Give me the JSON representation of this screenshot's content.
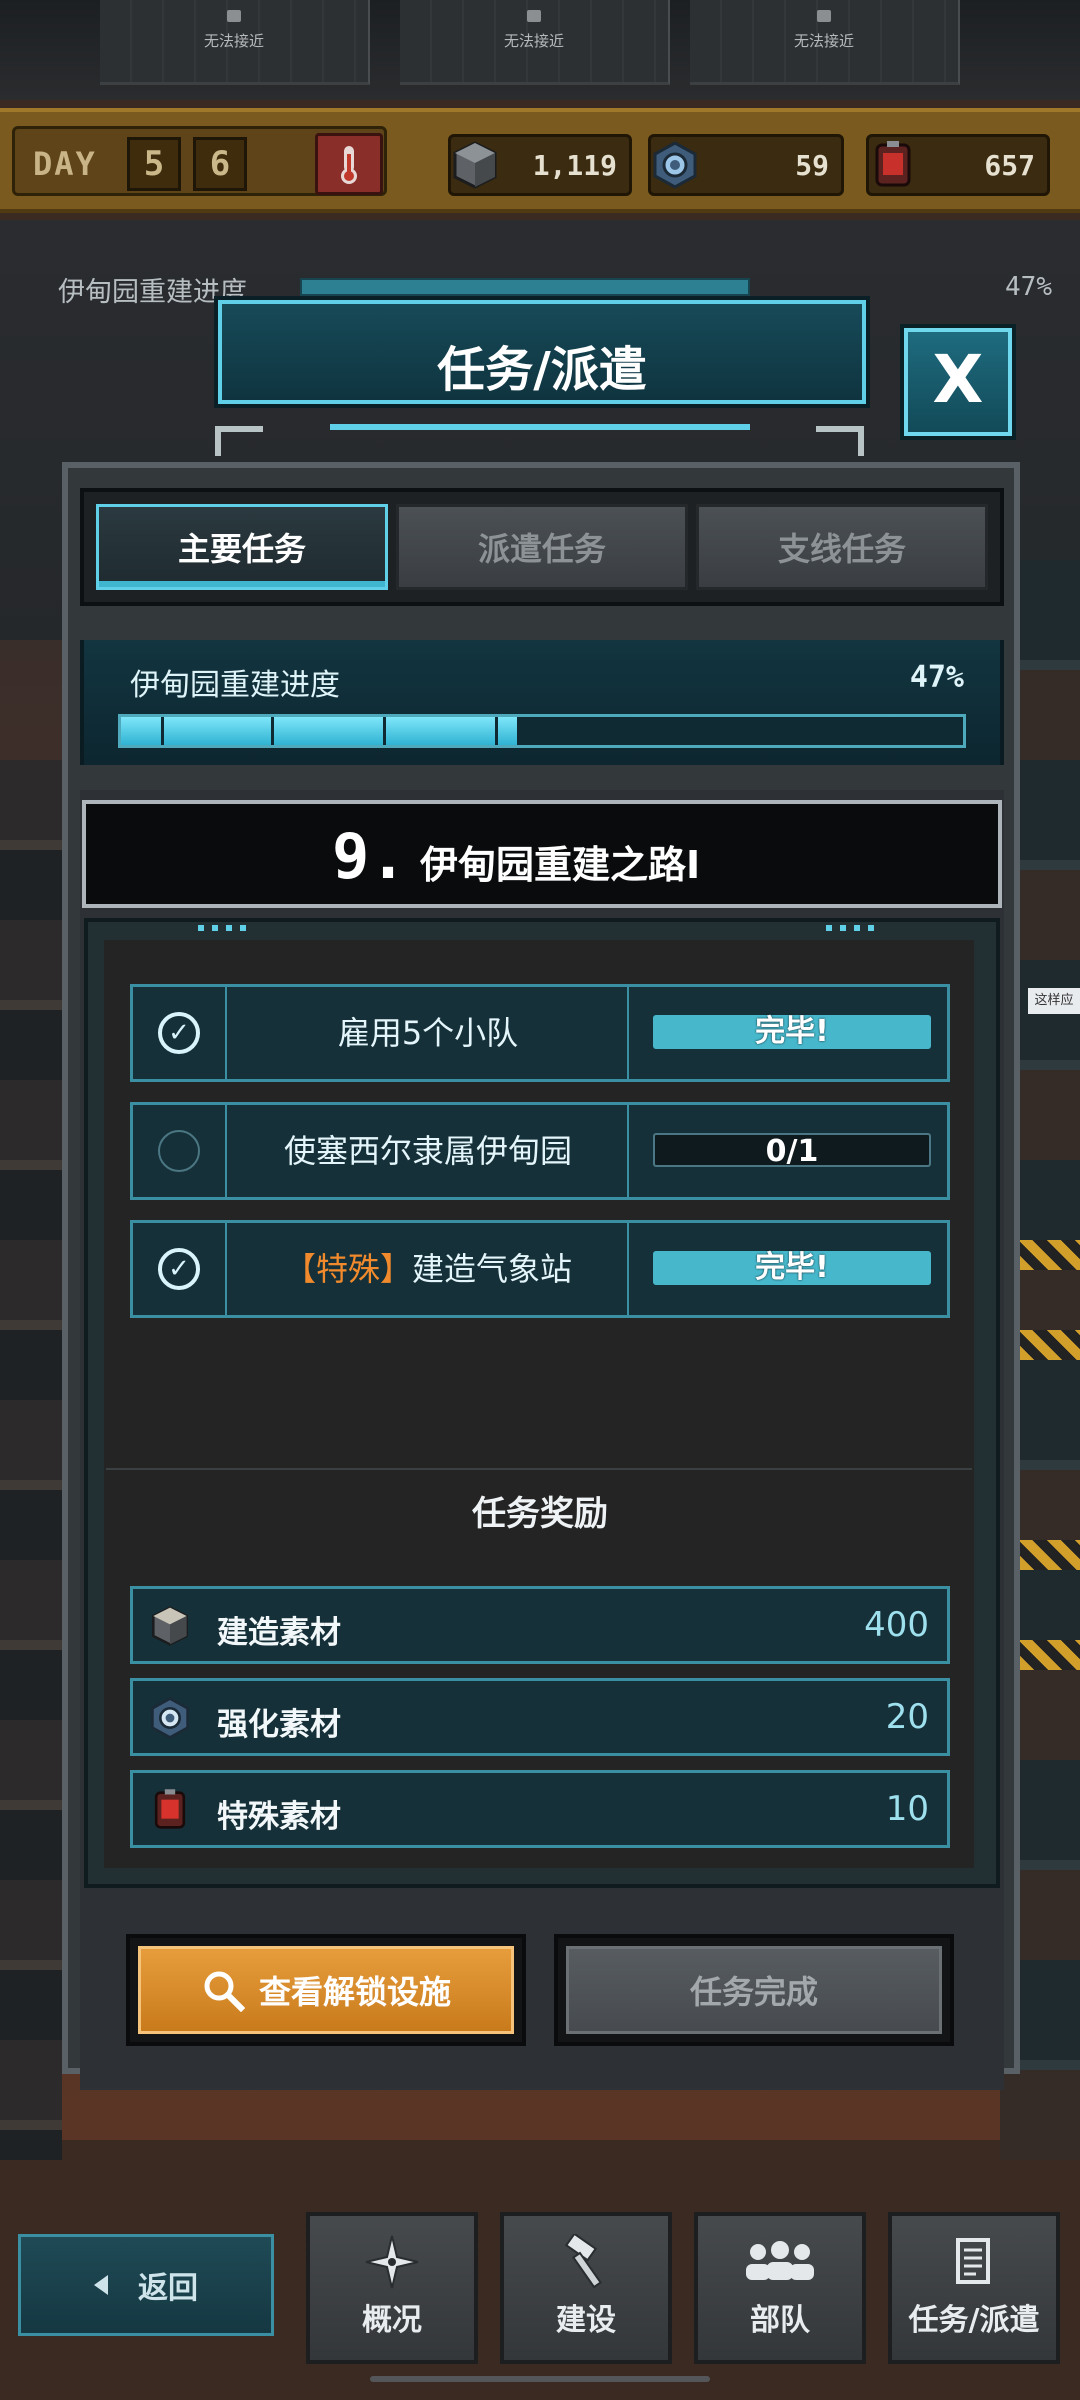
{
  "background": {
    "locked_slots": [
      "无法接近",
      "无法接近",
      "无法接近"
    ],
    "resource_bar": {
      "day_label": "DAY",
      "day_digits": [
        "5",
        "6"
      ],
      "resources": [
        {
          "name": "build-material",
          "icon": "build-material-icon",
          "value": "1,119"
        },
        {
          "name": "enhance-material",
          "icon": "gear-icon",
          "value": "59"
        },
        {
          "name": "special-material",
          "icon": "special-material-icon",
          "value": "657"
        }
      ]
    },
    "bg_progress_label": "伊甸园重建进度",
    "bg_progress_pct": "47%",
    "side_tag": "这样应"
  },
  "modal": {
    "title": "任务/派遣",
    "close_label": "X",
    "tabs": [
      {
        "label": "主要任务",
        "active": true
      },
      {
        "label": "派遣任务",
        "active": false
      },
      {
        "label": "支线任务",
        "active": false
      }
    ],
    "progress": {
      "label": "伊甸园重建进度",
      "percent_text": "47%",
      "fill_fraction": 0.47
    },
    "mission": {
      "number": "9.",
      "name": "伊甸园重建之路I"
    },
    "tasks": [
      {
        "name": "雇用5个小队",
        "special_prefix": "",
        "status": "完毕!",
        "done": true
      },
      {
        "name": "使塞西尔隶属伊甸园",
        "special_prefix": "",
        "status": "0/1",
        "done": false
      },
      {
        "name": "建造气象站",
        "special_prefix": "【特殊】",
        "status": "完毕!",
        "done": true
      }
    ],
    "rewards_title": "任务奖励",
    "rewards": [
      {
        "name": "建造素材",
        "icon": "build-material-icon",
        "value": "400"
      },
      {
        "name": "强化素材",
        "icon": "gear-icon",
        "value": "20"
      },
      {
        "name": "特殊素材",
        "icon": "special-material-icon",
        "value": "10"
      }
    ],
    "buttons": {
      "view_label": "查看解锁设施",
      "complete_label": "任务完成"
    }
  },
  "nav": {
    "back_label": "返回",
    "items": [
      {
        "label": "概况",
        "icon": "compass-star-icon"
      },
      {
        "label": "建设",
        "icon": "hammer-icon"
      },
      {
        "label": "部队",
        "icon": "people-icon"
      },
      {
        "label": "任务/派遣",
        "icon": "document-icon"
      }
    ]
  },
  "colors": {
    "accent_cyan": "#5fd0e8",
    "orange_button": "#e79d3c",
    "special_text": "#f08a2c"
  }
}
